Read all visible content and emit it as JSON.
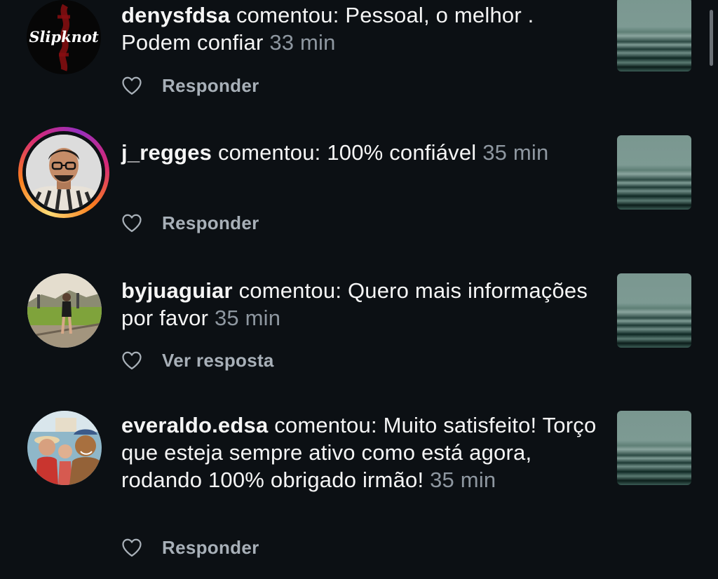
{
  "notifications": [
    {
      "username": "denysfdsa",
      "action": " comentou: ",
      "comment": "Pessoal,  o melhor . Podem confiar",
      "time": "33 min",
      "reply_label": "Responder",
      "avatar_text": "Slipknot"
    },
    {
      "username": "j_regges",
      "action": " comentou: ",
      "comment": "100% confiável",
      "time": "35 min",
      "reply_label": "Responder"
    },
    {
      "username": "byjuaguiar",
      "action": " comentou: ",
      "comment": "Quero mais informações por favor",
      "time": "35 min",
      "reply_label": "Ver resposta"
    },
    {
      "username": "everaldo.edsa",
      "action": " comentou: ",
      "comment": "Muito satisfeito! Torço que esteja sempre ativo como está agora, rodando 100% obrigado irmão!",
      "time": "35 min",
      "reply_label": "Responder"
    }
  ],
  "colors": {
    "background": "#0c1014",
    "text": "#f5f5f5",
    "muted": "#8e97a0",
    "reply": "#a8b0b8"
  },
  "icons": {
    "like": "heart-outline-icon"
  }
}
